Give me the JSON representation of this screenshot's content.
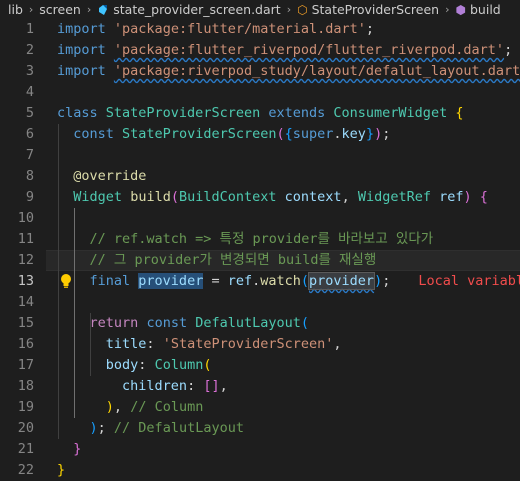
{
  "breadcrumb": {
    "segments": [
      "lib",
      "screen",
      "state_provider_screen.dart",
      "StateProviderScreen",
      "build"
    ],
    "separator": "›"
  },
  "editor": {
    "active_line": 13,
    "lines": [
      {
        "n": "1",
        "tokens": [
          [
            "kw",
            "import"
          ],
          [
            "plain",
            " "
          ],
          [
            "str",
            "'package:flutter/material.dart'"
          ],
          [
            "plain",
            ";"
          ]
        ]
      },
      {
        "n": "2",
        "tokens": [
          [
            "kw",
            "import"
          ],
          [
            "plain",
            " "
          ],
          [
            "str sq",
            "'package:flutter_riverpod/flutter_riverpod.dart'"
          ],
          [
            "plain",
            ";"
          ]
        ]
      },
      {
        "n": "3",
        "tokens": [
          [
            "kw",
            "import"
          ],
          [
            "plain",
            " "
          ],
          [
            "str sq",
            "'package:riverpod_study/layout/defalut_layout.dart'"
          ],
          [
            "plain",
            ";"
          ]
        ]
      },
      {
        "n": "4",
        "tokens": []
      },
      {
        "n": "5",
        "tokens": [
          [
            "kw",
            "class"
          ],
          [
            "plain",
            " "
          ],
          [
            "typ",
            "StateProviderScreen"
          ],
          [
            "plain",
            " "
          ],
          [
            "kw",
            "extends"
          ],
          [
            "plain",
            " "
          ],
          [
            "typ",
            "ConsumerWidget"
          ],
          [
            "plain",
            " "
          ],
          [
            "p1",
            "{"
          ]
        ]
      },
      {
        "n": "6",
        "tokens": [
          [
            "plain",
            "  "
          ],
          [
            "kw",
            "const"
          ],
          [
            "plain",
            " "
          ],
          [
            "typ",
            "StateProviderScreen"
          ],
          [
            "p2",
            "("
          ],
          [
            "p3",
            "{"
          ],
          [
            "kw",
            "super"
          ],
          [
            "plain",
            "."
          ],
          [
            "var",
            "key"
          ],
          [
            "p3",
            "}"
          ],
          [
            "p2",
            ")"
          ],
          [
            "plain",
            ";"
          ]
        ]
      },
      {
        "n": "7",
        "tokens": []
      },
      {
        "n": "8",
        "tokens": [
          [
            "plain",
            "  "
          ],
          [
            "fn",
            "@override"
          ]
        ]
      },
      {
        "n": "9",
        "tokens": [
          [
            "plain",
            "  "
          ],
          [
            "typ",
            "Widget"
          ],
          [
            "plain",
            " "
          ],
          [
            "fn",
            "build"
          ],
          [
            "p2",
            "("
          ],
          [
            "typ",
            "BuildContext"
          ],
          [
            "plain",
            " "
          ],
          [
            "var",
            "context"
          ],
          [
            "plain",
            ", "
          ],
          [
            "typ",
            "WidgetRef"
          ],
          [
            "plain",
            " "
          ],
          [
            "var",
            "ref"
          ],
          [
            "p2",
            ")"
          ],
          [
            "plain",
            " "
          ],
          [
            "p2",
            "{"
          ]
        ]
      },
      {
        "n": "10",
        "tokens": []
      },
      {
        "n": "11",
        "tokens": [
          [
            "plain",
            "    "
          ],
          [
            "cm",
            "// ref.watch => 특정 provider를 바라보고 있다가"
          ]
        ]
      },
      {
        "n": "12",
        "tokens": [
          [
            "plain",
            "    "
          ],
          [
            "cm",
            "// 그 provider가 변경되면 build를 재실행"
          ]
        ]
      },
      {
        "n": "13",
        "tokens": [
          [
            "plain",
            "    "
          ],
          [
            "kw",
            "final"
          ],
          [
            "plain",
            " "
          ],
          [
            "var hl",
            "provider"
          ],
          [
            "plain",
            " = "
          ],
          [
            "var",
            "ref"
          ],
          [
            "plain",
            "."
          ],
          [
            "fn",
            "watch"
          ],
          [
            "p3",
            "("
          ],
          [
            "var hl2 sq",
            "provider"
          ],
          [
            "p3",
            ")"
          ],
          [
            "plain",
            ";"
          ]
        ],
        "hint": "Local variable"
      },
      {
        "n": "14",
        "tokens": []
      },
      {
        "n": "15",
        "tokens": [
          [
            "plain",
            "    "
          ],
          [
            "kw2",
            "return"
          ],
          [
            "plain",
            " "
          ],
          [
            "kw",
            "const"
          ],
          [
            "plain",
            " "
          ],
          [
            "typ",
            "DefalutLayout"
          ],
          [
            "p3",
            "("
          ]
        ]
      },
      {
        "n": "16",
        "tokens": [
          [
            "plain",
            "      "
          ],
          [
            "var",
            "title"
          ],
          [
            "plain",
            ": "
          ],
          [
            "str",
            "'StateProviderScreen'"
          ],
          [
            "plain",
            ","
          ]
        ]
      },
      {
        "n": "17",
        "tokens": [
          [
            "plain",
            "      "
          ],
          [
            "var",
            "body"
          ],
          [
            "plain",
            ": "
          ],
          [
            "typ",
            "Column"
          ],
          [
            "p1",
            "("
          ]
        ]
      },
      {
        "n": "18",
        "tokens": [
          [
            "plain",
            "        "
          ],
          [
            "var",
            "children"
          ],
          [
            "plain",
            ": "
          ],
          [
            "p2",
            "[]"
          ],
          [
            "plain",
            ","
          ]
        ]
      },
      {
        "n": "19",
        "tokens": [
          [
            "plain",
            "      "
          ],
          [
            "p1",
            ")"
          ],
          [
            "plain",
            ", "
          ],
          [
            "cm",
            "// Column"
          ]
        ]
      },
      {
        "n": "20",
        "tokens": [
          [
            "plain",
            "    "
          ],
          [
            "p3",
            ")"
          ],
          [
            "plain",
            "; "
          ],
          [
            "cm",
            "// DefalutLayout"
          ]
        ]
      },
      {
        "n": "21",
        "tokens": [
          [
            "plain",
            "  "
          ],
          [
            "p2",
            "}"
          ]
        ]
      },
      {
        "n": "22",
        "tokens": [
          [
            "p1",
            "}"
          ]
        ]
      }
    ]
  },
  "colors": {
    "background": "#1e1e1e",
    "keyword": "#569cd6",
    "string": "#ce9178",
    "type": "#4ec9b0",
    "function": "#dcdcaa",
    "comment": "#6a9955",
    "hint": "#f14c4c"
  },
  "icons": [
    "dart-file-icon",
    "class-icon",
    "method-icon",
    "lightbulb-icon"
  ]
}
